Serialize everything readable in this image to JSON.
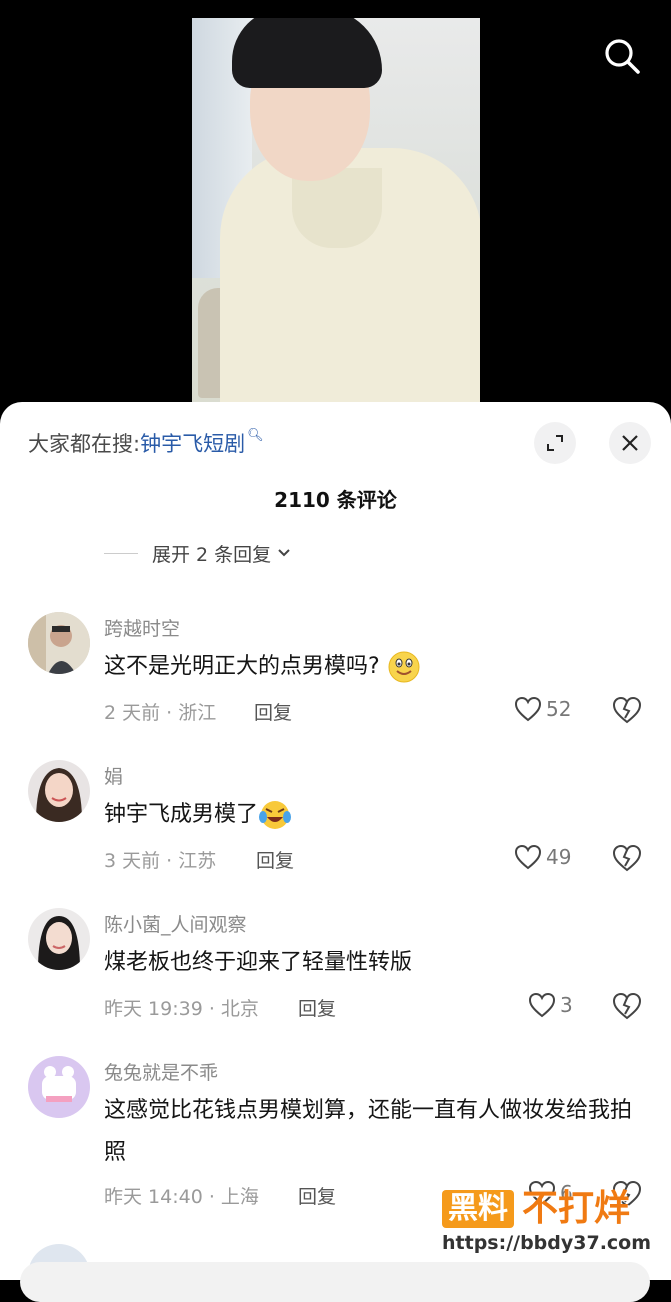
{
  "hot_search": {
    "prefix": "大家都在搜:",
    "keyword": "钟宇飞短剧"
  },
  "comments_header": {
    "count_label": "2110 条评论",
    "expand_replies": "展开 2 条回复"
  },
  "comments": [
    {
      "username": "跨越时空",
      "text": "这不是光明正大的点男模吗?",
      "emoji": "smiling-face-emoji",
      "time_location": "2 天前 · 浙江",
      "reply_label": "回复",
      "likes": "52"
    },
    {
      "username": "娟",
      "text": "钟宇飞成男模了",
      "emoji": "tears-of-joy-emoji",
      "time_location": "3 天前 · 江苏",
      "reply_label": "回复",
      "likes": "49"
    },
    {
      "username": "陈小菌_人间观察",
      "text": "煤老板也终于迎来了轻量性转版",
      "time_location": "昨天 19:39 · 北京",
      "reply_label": "回复",
      "likes": "3"
    },
    {
      "username": "兔兔就是不乖",
      "text": "这感觉比花钱点男模划算，还能一直有人做妆发给我拍照",
      "time_location": "昨天 14:40 · 上海",
      "reply_label": "回复",
      "likes": "6"
    }
  ],
  "watermark": {
    "badge": "黑料",
    "text": "不打烊",
    "url": "https://bbdy37.com"
  },
  "icons": {
    "search": "search-icon",
    "expand": "expand-icon",
    "close": "close-icon",
    "like": "heart-icon",
    "dislike": "broken-heart-icon"
  },
  "colors": {
    "keyword": "#2a5ba8",
    "watermark": "#f59a1b"
  }
}
